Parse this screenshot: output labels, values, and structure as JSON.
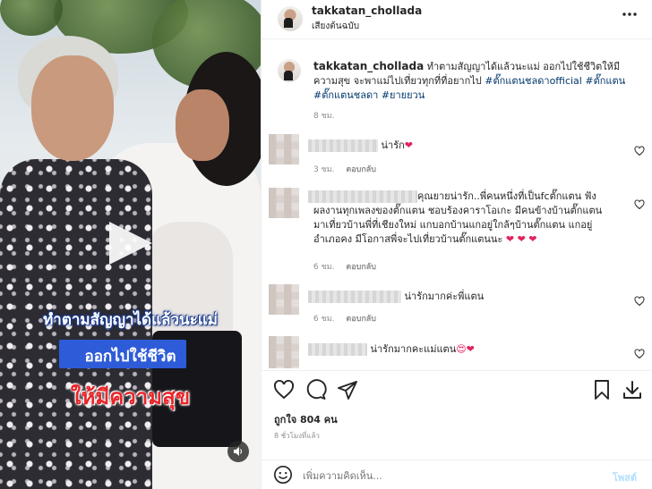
{
  "media": {
    "caption_lines": [
      "ทำตามสัญญาได้แล้วนะแม่",
      "ออกไปใช้ชีวิต",
      "ให้มีความสุข"
    ]
  },
  "header": {
    "username": "takkatan_chollada",
    "subtitle": "เสียงต้นฉบับ",
    "more_icon": "more-dots-icon"
  },
  "caption": {
    "username": "takkatan_chollada",
    "text": "ทำตามสัญญาได้แล้วนะแม่ ออกไปใช้ชีวิตให้มีความสุข จะพาแม่ไปเที่ยวทุกที่ที่อยากไป",
    "hashtags": [
      "#ตั๊กแตนชลดาofficial",
      "#ตั๊กแตน",
      "#ตั๊กแตนชลดา",
      "#ยายยวน"
    ],
    "time": "8 ชม."
  },
  "comments": [
    {
      "text": "น่ารัก",
      "emoji": "❤",
      "time": "3 ชม.",
      "reply_label": "ตอบกลับ"
    },
    {
      "text_lines": [
        "คุณยายน่ารัก..พี่คนหนึ่งที่เป็นfcตั๊กแตน ฟัง",
        "ผลงานทุกเพลงของตั๊กแตน ชอบร้องคาราโอเกะ มีคนข้างบ้านตั๊กแตน",
        "มาเที่ยวบ้านพี่ที่เชียงใหม่ แกบอกบ้านแกอยู่ใกล้ๆบ้านตั๊กแตน แกอยู่",
        "อำเภอคง มีโอกาสพี่จะไปเที่ยวบ้านตั๊กแตนนะ"
      ],
      "emoji": "❤ ❤ ❤",
      "time": "6 ชม.",
      "reply_label": "ตอบกลับ"
    },
    {
      "text": "น่ารักมากค่ะพี่แตน",
      "time": "6 ชม.",
      "reply_label": "ตอบกลับ"
    },
    {
      "text": "น่ารักมากคะแม่แตน",
      "emoji": "😍❤",
      "time": "",
      "reply_label": ""
    }
  ],
  "likes": {
    "text": "ถูกใจ 804 คน",
    "time_ago": "8 ชั่วโมงที่แล้ว"
  },
  "add_comment": {
    "placeholder": "เพิ่มความคิดเห็น...",
    "post_label": "โพสต์"
  },
  "colors": {
    "link": "#00376b",
    "post_button": "#b2dffc",
    "heart": "#e0245e"
  }
}
